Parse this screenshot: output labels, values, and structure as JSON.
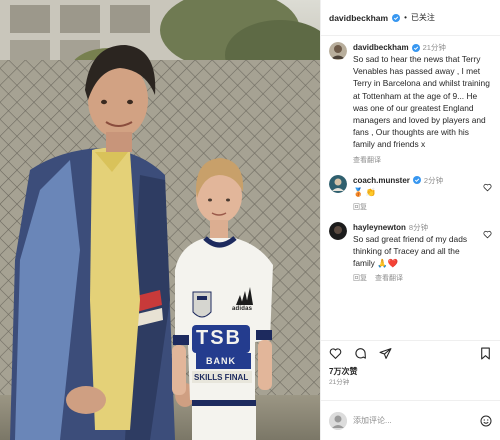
{
  "post": {
    "author": "davidbeckham",
    "follow_label": "已关注",
    "separator": "•",
    "likes": "7万次赞",
    "posted_ago": "21分钟",
    "comment_placeholder": "添加评论..."
  },
  "comments": [
    {
      "user": "davidbeckham",
      "time": "21分钟",
      "text": "So sad to hear the news that Terry Venables has passed away , I met Terry in Barcelona and whilst training at Tottenham at the age of 9... He was one of our greatest England managers and loved by players and fans , Our thoughts are with his family and friends x",
      "actions": [
        "查看翻译"
      ]
    },
    {
      "user": "coach.munster",
      "time": "2分钟",
      "text": "🥉 👏",
      "actions": [
        "回复"
      ]
    },
    {
      "user": "hayleynewton",
      "time": "8分钟",
      "text": "So sad great friend of my dads thinking of Tracey and all the family 🙏❤️",
      "actions": [
        "回复",
        "查看翻译"
      ]
    }
  ],
  "photo": {
    "shirt_badge": "adidas",
    "shirt_text_1": "TSB",
    "shirt_text_2": "BANK",
    "shirt_text_3": "SKILLS FINAL"
  },
  "colors": {
    "verified_blue": "#3897f0",
    "heart_red": "#ed4956",
    "muted": "#8e8e8e"
  },
  "icons": {
    "like": "heart-icon",
    "comment": "comment-icon",
    "share": "send-icon",
    "save": "bookmark-icon",
    "emoji": "emoji-icon",
    "verified": "verified-badge-icon"
  }
}
